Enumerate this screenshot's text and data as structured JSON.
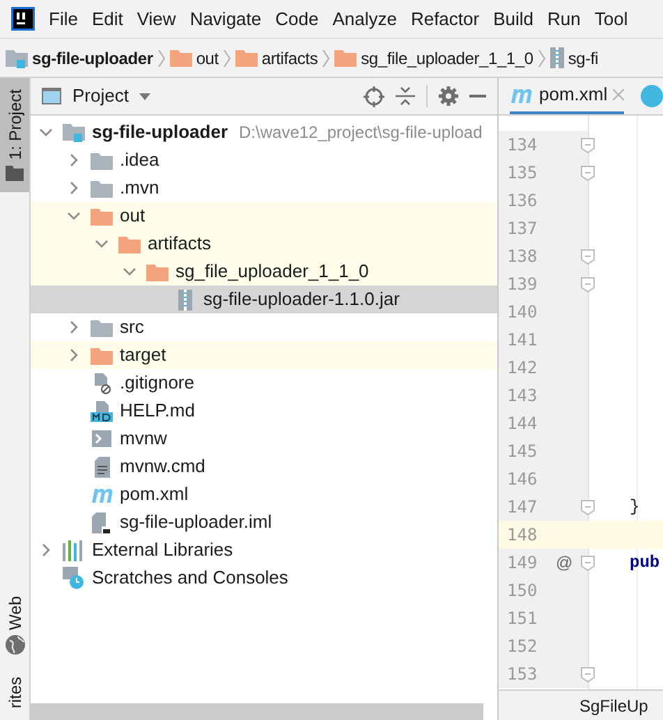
{
  "menu": [
    "File",
    "Edit",
    "View",
    "Navigate",
    "Code",
    "Analyze",
    "Refactor",
    "Build",
    "Run",
    "Tool"
  ],
  "breadcrumbs": [
    {
      "label": "sg-file-uploader",
      "kind": "module"
    },
    {
      "label": "out",
      "kind": "folder"
    },
    {
      "label": "artifacts",
      "kind": "folder"
    },
    {
      "label": "sg_file_uploader_1_1_0",
      "kind": "folder"
    },
    {
      "label": "sg-fi",
      "kind": "jar"
    }
  ],
  "side_tabs": [
    {
      "label": "1: Project",
      "selected": true,
      "kind": "folder"
    },
    {
      "label": "Web",
      "selected": false,
      "kind": "globe"
    },
    {
      "label": "rites",
      "selected": false,
      "kind": "none"
    }
  ],
  "project_panel": {
    "title": "Project",
    "tree": [
      {
        "label": "sg-file-uploader",
        "path": "D:\\wave12_project\\sg-file-upload",
        "kind": "module",
        "expanded": true,
        "excluded": false,
        "selected": false,
        "children": [
          {
            "label": ".idea",
            "kind": "folder",
            "expanded": false,
            "excluded": false,
            "selected": false
          },
          {
            "label": ".mvn",
            "kind": "folder",
            "expanded": false,
            "excluded": false,
            "selected": false
          },
          {
            "label": "out",
            "kind": "folder",
            "expanded": true,
            "excluded": true,
            "selected": false,
            "children": [
              {
                "label": "artifacts",
                "kind": "folder",
                "expanded": true,
                "excluded": true,
                "selected": false,
                "children": [
                  {
                    "label": "sg_file_uploader_1_1_0",
                    "kind": "folder",
                    "expanded": true,
                    "excluded": true,
                    "selected": false,
                    "children": [
                      {
                        "label": "sg-file-uploader-1.1.0.jar",
                        "kind": "jar",
                        "excluded": false,
                        "selected": true
                      }
                    ]
                  }
                ]
              }
            ]
          },
          {
            "label": "src",
            "kind": "folder",
            "expanded": false,
            "excluded": false,
            "selected": false
          },
          {
            "label": "target",
            "kind": "folder",
            "expanded": false,
            "excluded": true,
            "selected": false
          },
          {
            "label": ".gitignore",
            "kind": "ignore",
            "excluded": false,
            "selected": false
          },
          {
            "label": "HELP.md",
            "kind": "markdown",
            "excluded": false,
            "selected": false
          },
          {
            "label": "mvnw",
            "kind": "script",
            "excluded": false,
            "selected": false
          },
          {
            "label": "mvnw.cmd",
            "kind": "text",
            "excluded": false,
            "selected": false
          },
          {
            "label": "pom.xml",
            "kind": "maven",
            "excluded": false,
            "selected": false
          },
          {
            "label": "sg-file-uploader.iml",
            "kind": "iml",
            "excluded": false,
            "selected": false
          }
        ]
      },
      {
        "label": "External Libraries",
        "kind": "libraries",
        "expanded": false,
        "excluded": false,
        "selected": false
      },
      {
        "label": "Scratches and Consoles",
        "kind": "scratches",
        "excluded": false,
        "selected": false
      }
    ]
  },
  "editor": {
    "tabs": [
      {
        "label": "pom.xml",
        "selected": true
      }
    ],
    "lines": [
      {
        "number": "134",
        "fold": true,
        "current": false
      },
      {
        "number": "135",
        "fold": true,
        "current": false
      },
      {
        "number": "136",
        "fold": false,
        "current": false
      },
      {
        "number": "137",
        "fold": false,
        "current": false
      },
      {
        "number": "138",
        "fold": true,
        "current": false
      },
      {
        "number": "139",
        "fold": true,
        "current": false
      },
      {
        "number": "140",
        "fold": false,
        "current": false
      },
      {
        "number": "141",
        "fold": false,
        "current": false
      },
      {
        "number": "142",
        "fold": false,
        "current": false
      },
      {
        "number": "143",
        "fold": false,
        "current": false
      },
      {
        "number": "144",
        "fold": false,
        "current": false
      },
      {
        "number": "145",
        "fold": false,
        "current": false
      },
      {
        "number": "146",
        "fold": false,
        "current": false
      },
      {
        "number": "147",
        "fold": true,
        "current": false,
        "code": "}",
        "keyword": false
      },
      {
        "number": "148",
        "fold": false,
        "current": true
      },
      {
        "number": "149",
        "fold": true,
        "current": false,
        "annotation": "@",
        "code": "pub",
        "keyword": true
      },
      {
        "number": "150",
        "fold": false,
        "current": false
      },
      {
        "number": "151",
        "fold": false,
        "current": false
      },
      {
        "number": "152",
        "fold": false,
        "current": false
      },
      {
        "number": "153",
        "fold": true,
        "current": false
      }
    ],
    "breadcrumb": "SgFileUp"
  }
}
